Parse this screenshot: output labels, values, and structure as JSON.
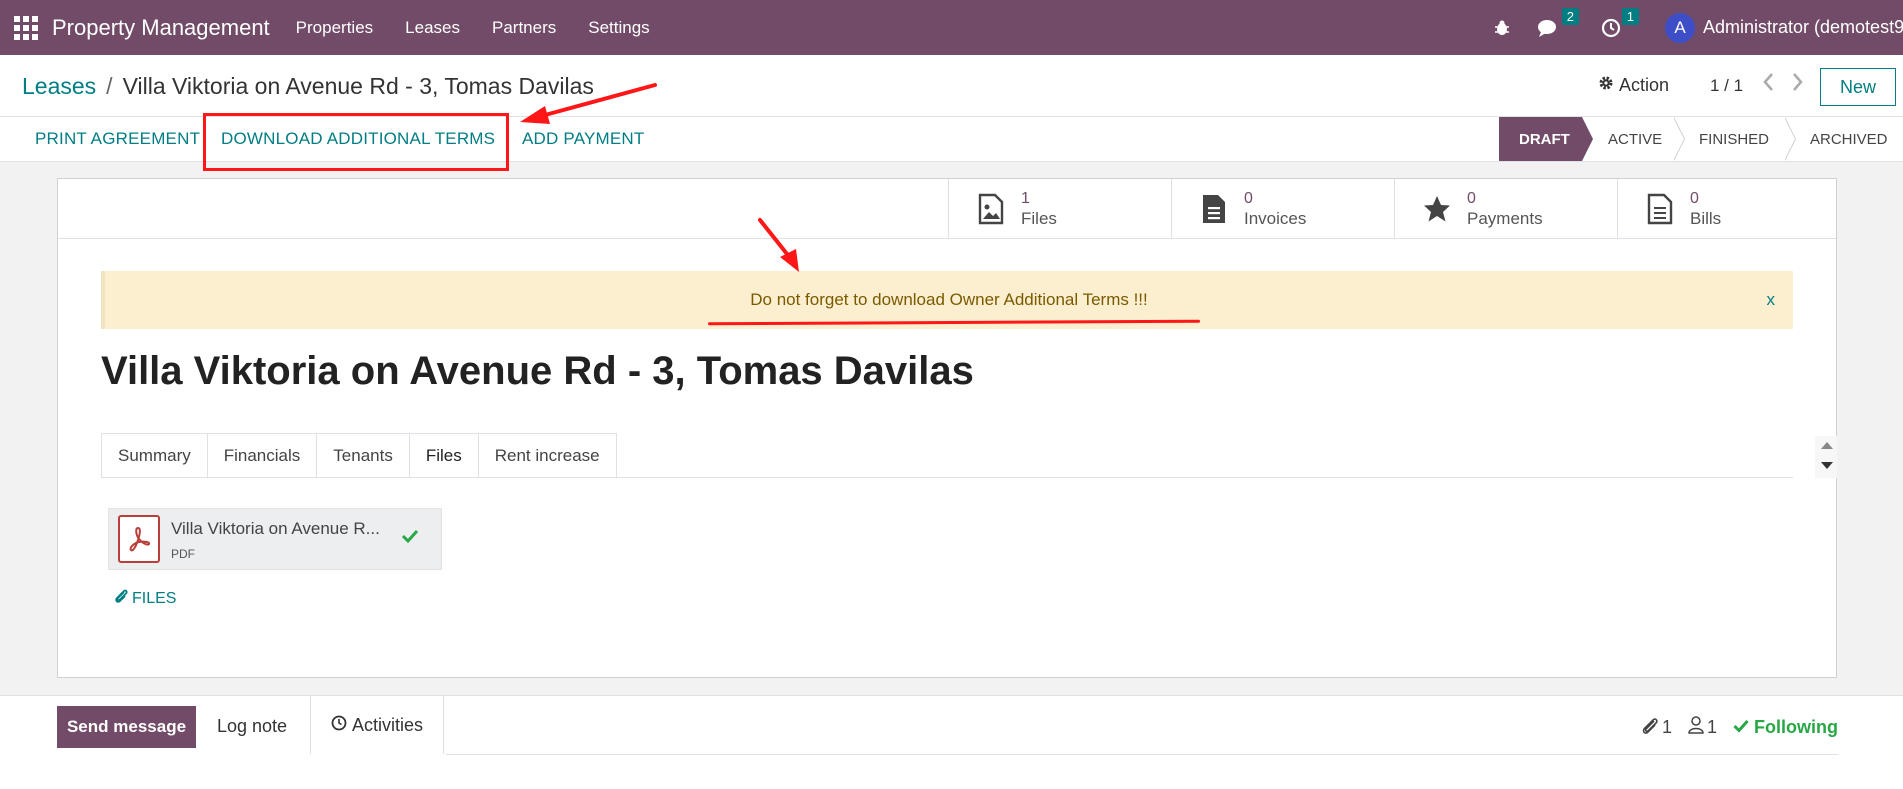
{
  "navbar": {
    "brand": "Property Management",
    "menu": [
      "Properties",
      "Leases",
      "Partners",
      "Settings"
    ],
    "messages_count": "2",
    "activities_count": "1",
    "avatar_letter": "A",
    "user": "Administrator (demotest9"
  },
  "control": {
    "breadcrumb_root": "Leases",
    "breadcrumb_sep": "/",
    "breadcrumb_current": "Villa Viktoria on Avenue Rd - 3, Tomas Davilas",
    "action_label": "Action",
    "pager": "1 / 1",
    "new_label": "New"
  },
  "buttons": {
    "print": "PRINT AGREEMENT",
    "download": "DOWNLOAD ADDITIONAL TERMS",
    "payment": "ADD PAYMENT"
  },
  "status": [
    "DRAFT",
    "ACTIVE",
    "FINISHED",
    "ARCHIVED"
  ],
  "stats": [
    {
      "value": "1",
      "label": "Files",
      "icon": "image-file-icon"
    },
    {
      "value": "0",
      "label": "Invoices",
      "icon": "document-icon"
    },
    {
      "value": "0",
      "label": "Payments",
      "icon": "star-icon"
    },
    {
      "value": "0",
      "label": "Bills",
      "icon": "bill-icon"
    }
  ],
  "alert": {
    "text": "Do not forget to download Owner Additional Terms !!!",
    "close": "x"
  },
  "record_title": "Villa Viktoria on Avenue Rd - 3, Tomas Davilas",
  "tabs": [
    "Summary",
    "Financials",
    "Tenants",
    "Files",
    "Rent increase"
  ],
  "file": {
    "name": "Villa Viktoria on Avenue R...",
    "type": "PDF"
  },
  "files_link": "FILES",
  "chatter": {
    "send": "Send message",
    "log": "Log note",
    "activities": "Activities",
    "attachments": "1",
    "followers": "1",
    "following": "Following"
  },
  "colors": {
    "brand": "#714b67",
    "accent": "#017e84",
    "annotation": "#ff1616"
  }
}
